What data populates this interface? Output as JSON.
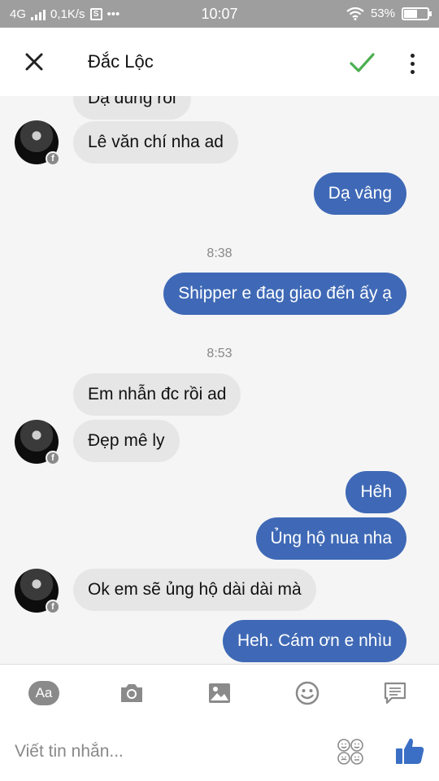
{
  "status_bar": {
    "network": "4G",
    "speed": "0,1K/s",
    "time": "10:07",
    "battery": "53%",
    "battery_level": 0.53
  },
  "header": {
    "title": "Đắc Lộc"
  },
  "messages": [
    {
      "text": "Dạ đúng rồi",
      "direction": "in"
    },
    {
      "text": "Lê văn chí nha ad",
      "direction": "in"
    },
    {
      "text": "Dạ vâng",
      "direction": "out"
    },
    {
      "timestamp": "8:38"
    },
    {
      "text": "Shipper e đag giao đến ấy ạ",
      "direction": "out"
    },
    {
      "timestamp": "8:53"
    },
    {
      "text": "Em nhẫn đc rồi ad",
      "direction": "in"
    },
    {
      "text": "Đẹp mê ly",
      "direction": "in"
    },
    {
      "text": "Hêh",
      "direction": "out"
    },
    {
      "text": "Ủng hộ nua nha",
      "direction": "out"
    },
    {
      "text": "Ok em sẽ ủng hộ dài dài mà",
      "direction": "in"
    },
    {
      "text": "Heh. Cám ơn e nhìu",
      "direction": "out"
    }
  ],
  "toolbar": {
    "aa_label": "Aa",
    "icons": [
      "text-style-icon",
      "camera-icon",
      "image-icon",
      "emoji-icon",
      "message-icon"
    ]
  },
  "composer": {
    "placeholder": "Viết tin nhắn..."
  },
  "colors": {
    "outgoing_bubble": "#3f69b6",
    "incoming_bubble": "#e6e6e6",
    "check_green": "#4caf50",
    "like_blue": "#3b6fc5"
  }
}
